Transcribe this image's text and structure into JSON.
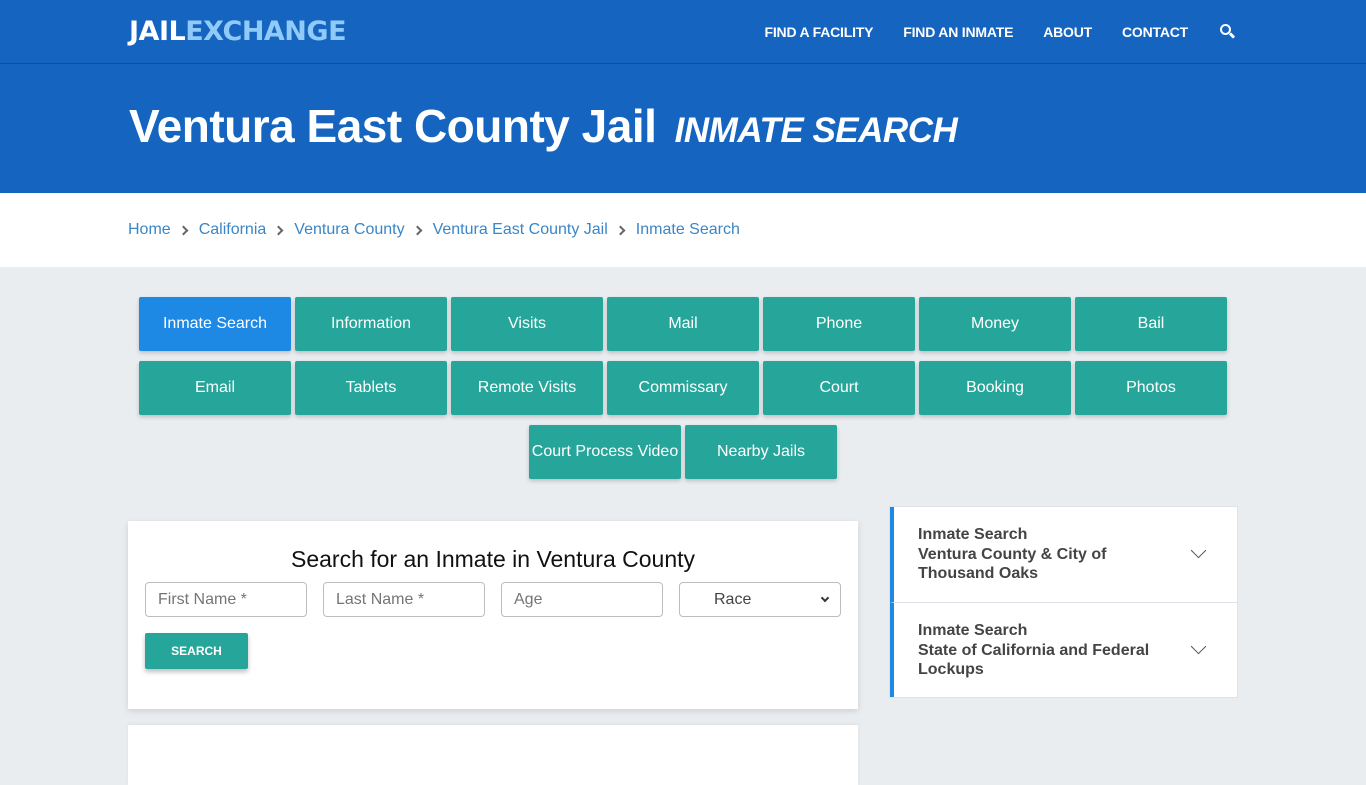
{
  "header": {
    "logo_part1": "JAIL",
    "logo_part2": "EXCHANGE",
    "nav": [
      {
        "label": "FIND A FACILITY"
      },
      {
        "label": "FIND AN INMATE"
      },
      {
        "label": "ABOUT"
      },
      {
        "label": "CONTACT"
      }
    ],
    "search_icon": "search-icon"
  },
  "hero": {
    "title": "Ventura East County Jail",
    "subtitle": "INMATE SEARCH"
  },
  "breadcrumb": [
    {
      "label": "Home"
    },
    {
      "label": "California"
    },
    {
      "label": "Ventura County"
    },
    {
      "label": "Ventura East County Jail"
    },
    {
      "label": "Inmate Search"
    }
  ],
  "tabs": {
    "row1": [
      {
        "label": "Inmate Search",
        "active": true
      },
      {
        "label": "Information"
      },
      {
        "label": "Visits"
      },
      {
        "label": "Mail"
      },
      {
        "label": "Phone"
      },
      {
        "label": "Money"
      },
      {
        "label": "Bail"
      }
    ],
    "row2": [
      {
        "label": "Email"
      },
      {
        "label": "Tablets"
      },
      {
        "label": "Remote Visits"
      },
      {
        "label": "Commissary"
      },
      {
        "label": "Court"
      },
      {
        "label": "Booking"
      },
      {
        "label": "Photos"
      }
    ],
    "row3": [
      {
        "label": "Court Process Video"
      },
      {
        "label": "Nearby Jails"
      }
    ]
  },
  "search_form": {
    "heading": "Search for an Inmate in Ventura County",
    "first_name_placeholder": "First Name *",
    "last_name_placeholder": "Last Name *",
    "age_placeholder": "Age",
    "race_selected": "Race",
    "submit_label": "SEARCH"
  },
  "accordion": [
    {
      "line1": "Inmate Search",
      "line2": "Ventura County & City of Thousand Oaks"
    },
    {
      "line1": "Inmate Search",
      "line2": "State of California and Federal Lockups"
    }
  ],
  "colors": {
    "brand_blue": "#1565c0",
    "logo_accent": "#90caf9",
    "tab_teal": "#26a69a",
    "tab_active": "#1e88e5",
    "link": "#3a86c8"
  }
}
